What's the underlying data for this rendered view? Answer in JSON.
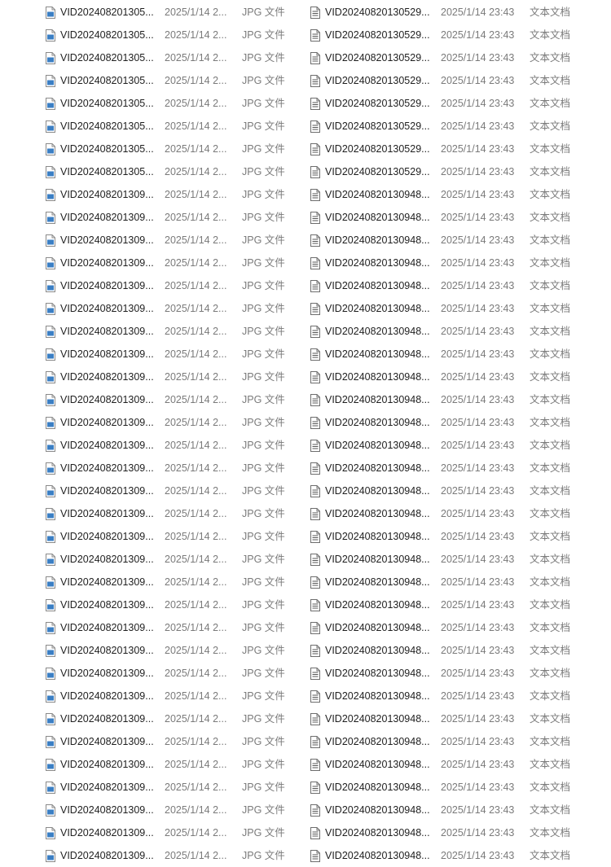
{
  "colors": {
    "text": "#1f1f1f",
    "meta": "#7a7a7a",
    "jpg_icon_accent": "#3b7fc4",
    "txt_icon_line": "#555555"
  },
  "icons": {
    "left_column": "jpg-file-icon",
    "right_column": "text-document-icon"
  },
  "rows": [
    {
      "l_name": "VID202408201305...",
      "l_date": "2025/1/14 2...",
      "l_type": "JPG 文件",
      "r_name": "VID20240820130529...",
      "r_date": "2025/1/14 23:43",
      "r_type": "文本文档"
    },
    {
      "l_name": "VID202408201305...",
      "l_date": "2025/1/14 2...",
      "l_type": "JPG 文件",
      "r_name": "VID20240820130529...",
      "r_date": "2025/1/14 23:43",
      "r_type": "文本文档"
    },
    {
      "l_name": "VID202408201305...",
      "l_date": "2025/1/14 2...",
      "l_type": "JPG 文件",
      "r_name": "VID20240820130529...",
      "r_date": "2025/1/14 23:43",
      "r_type": "文本文档"
    },
    {
      "l_name": "VID202408201305...",
      "l_date": "2025/1/14 2...",
      "l_type": "JPG 文件",
      "r_name": "VID20240820130529...",
      "r_date": "2025/1/14 23:43",
      "r_type": "文本文档"
    },
    {
      "l_name": "VID202408201305...",
      "l_date": "2025/1/14 2...",
      "l_type": "JPG 文件",
      "r_name": "VID20240820130529...",
      "r_date": "2025/1/14 23:43",
      "r_type": "文本文档"
    },
    {
      "l_name": "VID202408201305...",
      "l_date": "2025/1/14 2...",
      "l_type": "JPG 文件",
      "r_name": "VID20240820130529...",
      "r_date": "2025/1/14 23:43",
      "r_type": "文本文档"
    },
    {
      "l_name": "VID202408201305...",
      "l_date": "2025/1/14 2...",
      "l_type": "JPG 文件",
      "r_name": "VID20240820130529...",
      "r_date": "2025/1/14 23:43",
      "r_type": "文本文档"
    },
    {
      "l_name": "VID202408201305...",
      "l_date": "2025/1/14 2...",
      "l_type": "JPG 文件",
      "r_name": "VID20240820130529...",
      "r_date": "2025/1/14 23:43",
      "r_type": "文本文档"
    },
    {
      "l_name": "VID202408201309...",
      "l_date": "2025/1/14 2...",
      "l_type": "JPG 文件",
      "r_name": "VID20240820130948...",
      "r_date": "2025/1/14 23:43",
      "r_type": "文本文档"
    },
    {
      "l_name": "VID202408201309...",
      "l_date": "2025/1/14 2...",
      "l_type": "JPG 文件",
      "r_name": "VID20240820130948...",
      "r_date": "2025/1/14 23:43",
      "r_type": "文本文档"
    },
    {
      "l_name": "VID202408201309...",
      "l_date": "2025/1/14 2...",
      "l_type": "JPG 文件",
      "r_name": "VID20240820130948...",
      "r_date": "2025/1/14 23:43",
      "r_type": "文本文档"
    },
    {
      "l_name": "VID202408201309...",
      "l_date": "2025/1/14 2...",
      "l_type": "JPG 文件",
      "r_name": "VID20240820130948...",
      "r_date": "2025/1/14 23:43",
      "r_type": "文本文档"
    },
    {
      "l_name": "VID202408201309...",
      "l_date": "2025/1/14 2...",
      "l_type": "JPG 文件",
      "r_name": "VID20240820130948...",
      "r_date": "2025/1/14 23:43",
      "r_type": "文本文档"
    },
    {
      "l_name": "VID202408201309...",
      "l_date": "2025/1/14 2...",
      "l_type": "JPG 文件",
      "r_name": "VID20240820130948...",
      "r_date": "2025/1/14 23:43",
      "r_type": "文本文档"
    },
    {
      "l_name": "VID202408201309...",
      "l_date": "2025/1/14 2...",
      "l_type": "JPG 文件",
      "r_name": "VID20240820130948...",
      "r_date": "2025/1/14 23:43",
      "r_type": "文本文档"
    },
    {
      "l_name": "VID202408201309...",
      "l_date": "2025/1/14 2...",
      "l_type": "JPG 文件",
      "r_name": "VID20240820130948...",
      "r_date": "2025/1/14 23:43",
      "r_type": "文本文档"
    },
    {
      "l_name": "VID202408201309...",
      "l_date": "2025/1/14 2...",
      "l_type": "JPG 文件",
      "r_name": "VID20240820130948...",
      "r_date": "2025/1/14 23:43",
      "r_type": "文本文档"
    },
    {
      "l_name": "VID202408201309...",
      "l_date": "2025/1/14 2...",
      "l_type": "JPG 文件",
      "r_name": "VID20240820130948...",
      "r_date": "2025/1/14 23:43",
      "r_type": "文本文档"
    },
    {
      "l_name": "VID202408201309...",
      "l_date": "2025/1/14 2...",
      "l_type": "JPG 文件",
      "r_name": "VID20240820130948...",
      "r_date": "2025/1/14 23:43",
      "r_type": "文本文档"
    },
    {
      "l_name": "VID202408201309...",
      "l_date": "2025/1/14 2...",
      "l_type": "JPG 文件",
      "r_name": "VID20240820130948...",
      "r_date": "2025/1/14 23:43",
      "r_type": "文本文档"
    },
    {
      "l_name": "VID202408201309...",
      "l_date": "2025/1/14 2...",
      "l_type": "JPG 文件",
      "r_name": "VID20240820130948...",
      "r_date": "2025/1/14 23:43",
      "r_type": "文本文档"
    },
    {
      "l_name": "VID202408201309...",
      "l_date": "2025/1/14 2...",
      "l_type": "JPG 文件",
      "r_name": "VID20240820130948...",
      "r_date": "2025/1/14 23:43",
      "r_type": "文本文档"
    },
    {
      "l_name": "VID202408201309...",
      "l_date": "2025/1/14 2...",
      "l_type": "JPG 文件",
      "r_name": "VID20240820130948...",
      "r_date": "2025/1/14 23:43",
      "r_type": "文本文档"
    },
    {
      "l_name": "VID202408201309...",
      "l_date": "2025/1/14 2...",
      "l_type": "JPG 文件",
      "r_name": "VID20240820130948...",
      "r_date": "2025/1/14 23:43",
      "r_type": "文本文档"
    },
    {
      "l_name": "VID202408201309...",
      "l_date": "2025/1/14 2...",
      "l_type": "JPG 文件",
      "r_name": "VID20240820130948...",
      "r_date": "2025/1/14 23:43",
      "r_type": "文本文档"
    },
    {
      "l_name": "VID202408201309...",
      "l_date": "2025/1/14 2...",
      "l_type": "JPG 文件",
      "r_name": "VID20240820130948...",
      "r_date": "2025/1/14 23:43",
      "r_type": "文本文档"
    },
    {
      "l_name": "VID202408201309...",
      "l_date": "2025/1/14 2...",
      "l_type": "JPG 文件",
      "r_name": "VID20240820130948...",
      "r_date": "2025/1/14 23:43",
      "r_type": "文本文档"
    },
    {
      "l_name": "VID202408201309...",
      "l_date": "2025/1/14 2...",
      "l_type": "JPG 文件",
      "r_name": "VID20240820130948...",
      "r_date": "2025/1/14 23:43",
      "r_type": "文本文档"
    },
    {
      "l_name": "VID202408201309...",
      "l_date": "2025/1/14 2...",
      "l_type": "JPG 文件",
      "r_name": "VID20240820130948...",
      "r_date": "2025/1/14 23:43",
      "r_type": "文本文档"
    },
    {
      "l_name": "VID202408201309...",
      "l_date": "2025/1/14 2...",
      "l_type": "JPG 文件",
      "r_name": "VID20240820130948...",
      "r_date": "2025/1/14 23:43",
      "r_type": "文本文档"
    },
    {
      "l_name": "VID202408201309...",
      "l_date": "2025/1/14 2...",
      "l_type": "JPG 文件",
      "r_name": "VID20240820130948...",
      "r_date": "2025/1/14 23:43",
      "r_type": "文本文档"
    },
    {
      "l_name": "VID202408201309...",
      "l_date": "2025/1/14 2...",
      "l_type": "JPG 文件",
      "r_name": "VID20240820130948...",
      "r_date": "2025/1/14 23:43",
      "r_type": "文本文档"
    },
    {
      "l_name": "VID202408201309...",
      "l_date": "2025/1/14 2...",
      "l_type": "JPG 文件",
      "r_name": "VID20240820130948...",
      "r_date": "2025/1/14 23:43",
      "r_type": "文本文档"
    },
    {
      "l_name": "VID202408201309...",
      "l_date": "2025/1/14 2...",
      "l_type": "JPG 文件",
      "r_name": "VID20240820130948...",
      "r_date": "2025/1/14 23:43",
      "r_type": "文本文档"
    },
    {
      "l_name": "VID202408201309...",
      "l_date": "2025/1/14 2...",
      "l_type": "JPG 文件",
      "r_name": "VID20240820130948...",
      "r_date": "2025/1/14 23:43",
      "r_type": "文本文档"
    },
    {
      "l_name": "VID202408201309...",
      "l_date": "2025/1/14 2...",
      "l_type": "JPG 文件",
      "r_name": "VID20240820130948...",
      "r_date": "2025/1/14 23:43",
      "r_type": "文本文档"
    },
    {
      "l_name": "VID202408201309...",
      "l_date": "2025/1/14 2...",
      "l_type": "JPG 文件",
      "r_name": "VID20240820130948...",
      "r_date": "2025/1/14 23:43",
      "r_type": "文本文档"
    },
    {
      "l_name": "VID202408201309...",
      "l_date": "2025/1/14 2...",
      "l_type": "JPG 文件",
      "r_name": "VID20240820130948...",
      "r_date": "2025/1/14 23:43",
      "r_type": "文本文档"
    }
  ]
}
